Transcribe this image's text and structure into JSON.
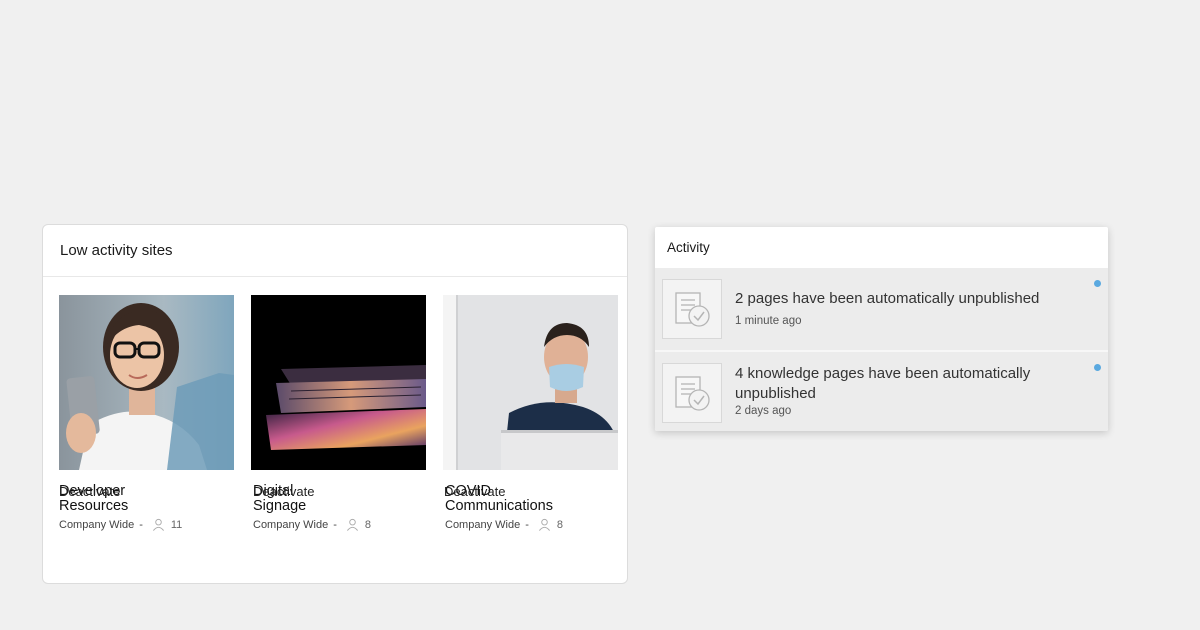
{
  "low_activity": {
    "title": "Low activity sites",
    "sites": [
      {
        "name_line1": "Developer",
        "name_line2": "Resources",
        "scope": "Company Wide",
        "members": "11",
        "action": "Deactivate",
        "thumbnail": "woman-with-phone-photo"
      },
      {
        "name_line1": "Digital",
        "name_line2": "Signage",
        "scope": "Company Wide",
        "members": "8",
        "action": "Deactivate",
        "thumbnail": "laptop-glow-photo"
      },
      {
        "name_line1": "COVID",
        "name_line2": "Communications",
        "scope": "Company Wide",
        "members": "8",
        "action": "Deactivate",
        "thumbnail": "man-with-mask-photo"
      }
    ]
  },
  "activity": {
    "title": "Activity",
    "items": [
      {
        "message": "2 pages have been automatically unpublished",
        "time": "1 minute ago",
        "icon": "document-check-icon",
        "unread": true
      },
      {
        "message": "4 knowledge pages have been automatically unpublished",
        "time": "2 days ago",
        "icon": "document-check-icon",
        "unread": true
      }
    ]
  },
  "colors": {
    "background": "#f0f0f0",
    "card": "#ffffff",
    "unread_dot": "#5aa9e0",
    "activity_item_bg": "#ececec"
  }
}
